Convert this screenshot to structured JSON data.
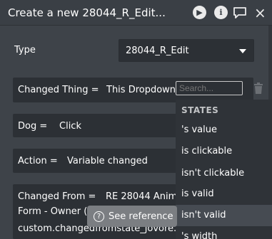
{
  "window": {
    "title": "Create a new 28044_R_Edit..."
  },
  "type_field": {
    "label": "Type",
    "value": "28044_R_Edit"
  },
  "fields": {
    "changed_thing": {
      "label": "Changed Thing =",
      "value": "This Dropdown"
    },
    "dog": {
      "label": "Dog =",
      "value": "Click"
    },
    "action": {
      "label": "Action =",
      "value": "Variable changed"
    },
    "changed_from": {
      "label": "Changed From =",
      "value_line1": "RE 28044 Anima",
      "value_line2": "Form - Owner (l",
      "value_line3": "custom.changedfromstate_jovore..."
    }
  },
  "search": {
    "placeholder": "Search..."
  },
  "dropdown": {
    "header": "STATES",
    "items": [
      "'s value",
      "is clickable",
      "isn't clickable",
      "is valid",
      "isn't valid",
      "'s width"
    ],
    "highlighted_index": 4
  },
  "tooltip": {
    "text": "See reference"
  },
  "icons": {
    "play": "play-icon",
    "info": "info-icon",
    "comment": "comment-icon",
    "close": "close-icon",
    "trash": "trash-icon",
    "question": "question-icon"
  },
  "colors": {
    "background": "#3e4349",
    "field_bg": "#2c3035",
    "yellow_value": "#f5c42c",
    "blue_value": "#5eb3ff",
    "red_value": "#ff3c3c",
    "dropdown_bg": "#2f3338",
    "dropdown_highlight": "#464b52"
  }
}
